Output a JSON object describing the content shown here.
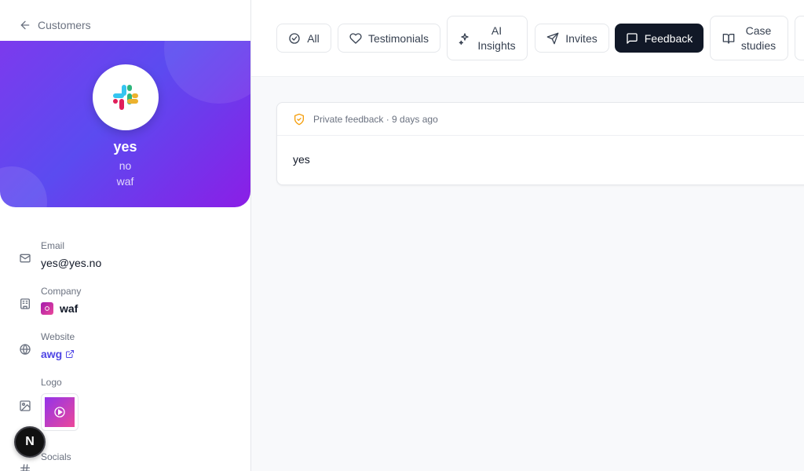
{
  "sidebar": {
    "back_label": "Customers",
    "profile": {
      "name": "yes",
      "title": "no",
      "company": "waf"
    },
    "fields": {
      "email": {
        "label": "Email",
        "value": "yes@yes.no"
      },
      "company": {
        "label": "Company",
        "value": "waf"
      },
      "website": {
        "label": "Website",
        "value": "awg"
      },
      "logo": {
        "label": "Logo"
      },
      "socials": {
        "label": "Socials"
      }
    },
    "fab_letter": "N"
  },
  "tabs": [
    {
      "label": "All",
      "icon": "check-circle-icon"
    },
    {
      "label": "Testimonials",
      "icon": "heart-icon"
    },
    {
      "label_line1": "AI",
      "label_line2": "Insights",
      "icon": "sparkles-icon"
    },
    {
      "label": "Invites",
      "icon": "send-icon"
    },
    {
      "label": "Feedback",
      "icon": "message-square-icon",
      "active": true
    },
    {
      "label_line1": "Case",
      "label_line2": "studies",
      "icon": "book-open-icon"
    }
  ],
  "feedback": {
    "meta": "Private feedback · 9 days ago",
    "body": "yes"
  },
  "colors": {
    "accent": "#4f46e5",
    "hero_start": "#7c3aed",
    "hero_end": "#8b1ee6",
    "active_tab": "#111827",
    "shield": "#f59e0b"
  }
}
